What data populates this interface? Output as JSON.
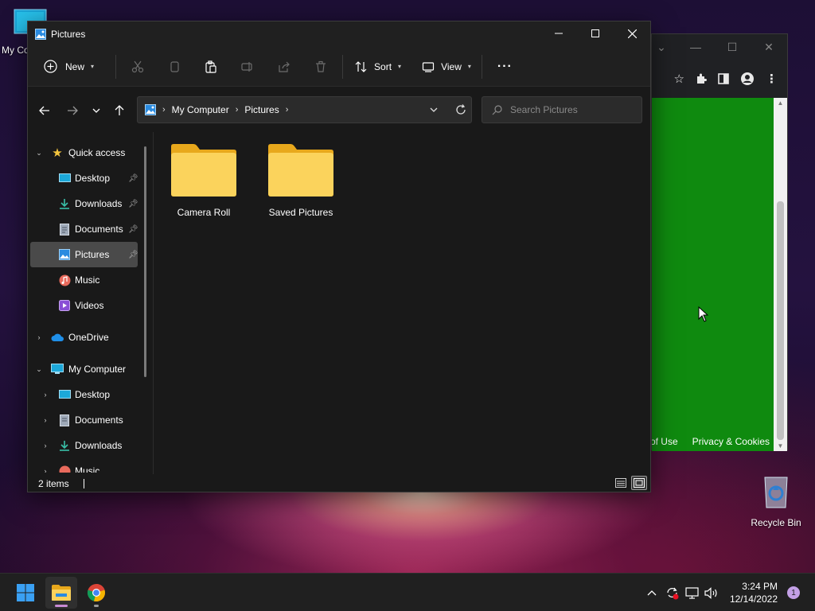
{
  "desktop": {
    "icons": [
      {
        "label": "My Co"
      },
      {
        "label": "Recycle Bin"
      }
    ]
  },
  "browser": {
    "footer_links": [
      "of Use",
      "Privacy & Cookies"
    ],
    "content_color": "#0f8a0f"
  },
  "explorer": {
    "title": "Pictures",
    "commands": {
      "new_label": "New",
      "sort_label": "Sort",
      "view_label": "View",
      "more_label": "···"
    },
    "address": {
      "crumbs": [
        "My Computer",
        "Pictures"
      ]
    },
    "search": {
      "placeholder": "Search Pictures"
    },
    "nav": {
      "quick_access": "Quick access",
      "quick_items": [
        {
          "label": "Desktop",
          "icon": "desktop-icon"
        },
        {
          "label": "Downloads",
          "icon": "download-icon"
        },
        {
          "label": "Documents",
          "icon": "document-icon"
        },
        {
          "label": "Pictures",
          "icon": "pictures-icon"
        },
        {
          "label": "Music",
          "icon": "music-icon"
        },
        {
          "label": "Videos",
          "icon": "videos-icon"
        }
      ],
      "onedrive": "OneDrive",
      "my_computer": "My Computer",
      "computer_items": [
        {
          "label": "Desktop"
        },
        {
          "label": "Documents"
        },
        {
          "label": "Downloads"
        },
        {
          "label": "Music"
        }
      ]
    },
    "files": [
      {
        "name": "Camera Roll"
      },
      {
        "name": "Saved Pictures"
      }
    ],
    "status": {
      "items_count": "2 items"
    }
  },
  "taskbar": {
    "clock_time": "3:24 PM",
    "clock_date": "12/14/2022",
    "notification_count": "1"
  },
  "colors": {
    "accent_folder": "#f7c948",
    "window_bg": "#191919",
    "taskbar_bg": "#202020"
  }
}
